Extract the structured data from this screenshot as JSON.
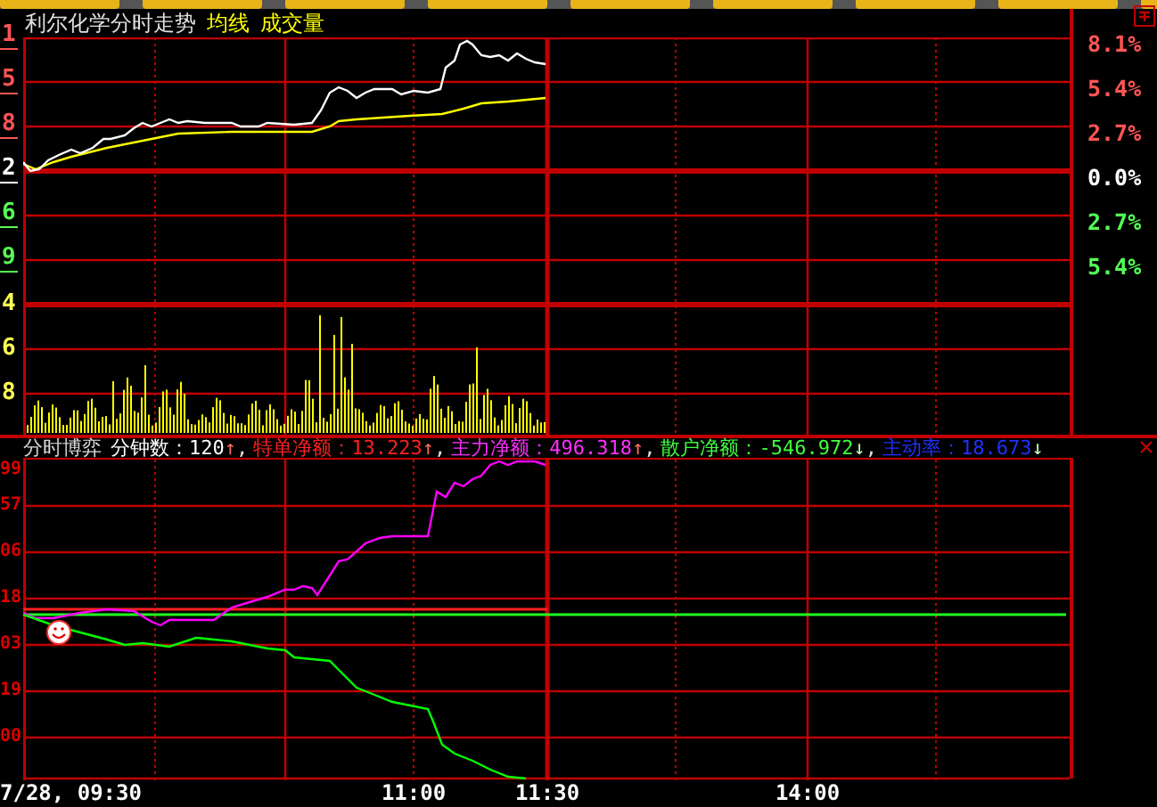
{
  "price_panel": {
    "title": "利尔化学分时走势",
    "legend": [
      "均线",
      "成交量"
    ],
    "left_axis": [
      {
        "label": "1",
        "kind": "up"
      },
      {
        "label": "5",
        "kind": "up"
      },
      {
        "label": "8",
        "kind": "up"
      },
      {
        "label": "2",
        "kind": "flat"
      },
      {
        "label": "6",
        "kind": "down"
      },
      {
        "label": "9",
        "kind": "down"
      },
      {
        "label": "4",
        "kind": "volume"
      },
      {
        "label": "6",
        "kind": "volume"
      },
      {
        "label": "8",
        "kind": "volume"
      }
    ],
    "right_axis": [
      {
        "label": "8.1%",
        "kind": "up"
      },
      {
        "label": "5.4%",
        "kind": "up"
      },
      {
        "label": "2.7%",
        "kind": "up"
      },
      {
        "label": "0.0%",
        "kind": "flat"
      },
      {
        "label": "2.7%",
        "kind": "down"
      },
      {
        "label": "5.4%",
        "kind": "down"
      }
    ]
  },
  "indicator_panel": {
    "title": "分时博弈",
    "readouts": [
      {
        "kind": "count",
        "text": "分钟数：120",
        "arrow": "↑",
        "separator": ","
      },
      {
        "kind": "special",
        "text": "特单净额：13.223",
        "arrow": "↑",
        "separator": ","
      },
      {
        "kind": "main",
        "text": "主力净额：496.318",
        "arrow": "↑",
        "separator": ","
      },
      {
        "kind": "retail",
        "text": "散户净额：-546.972",
        "arrow": "↓",
        "separator": ","
      },
      {
        "kind": "active",
        "text": "主动率：18.673",
        "arrow": "↓"
      }
    ],
    "left_axis": [
      "99",
      "57",
      "06",
      "18",
      "03",
      "19",
      "00"
    ]
  },
  "time_axis": [
    "7/28, 09:30",
    "11:00",
    "11:30",
    "14:00"
  ]
}
